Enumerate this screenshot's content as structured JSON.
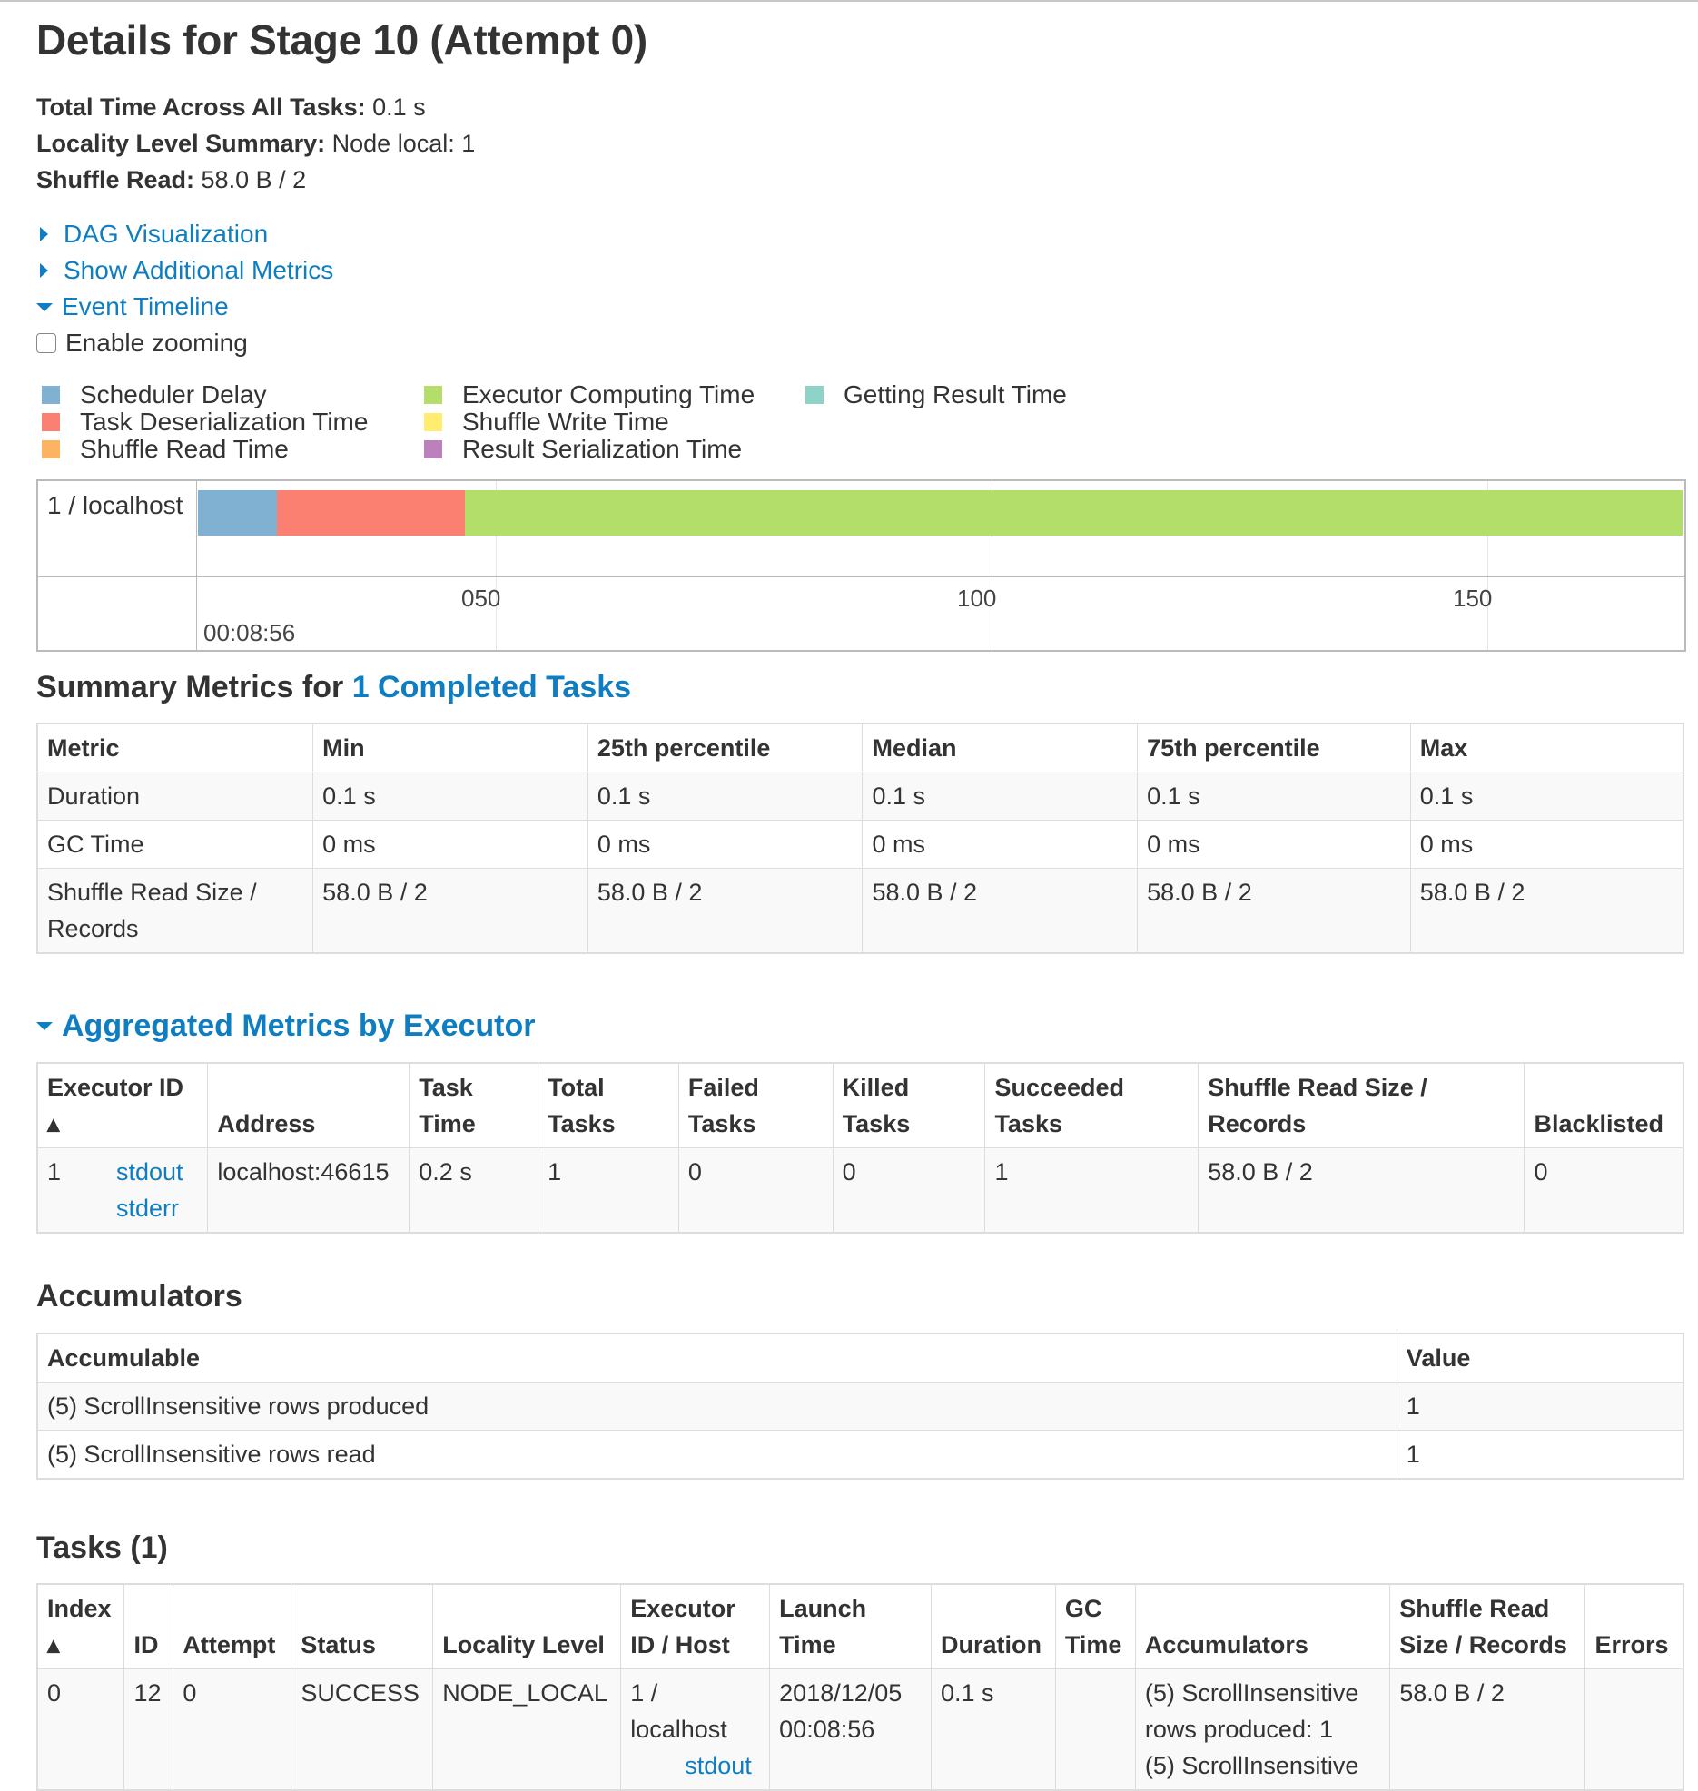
{
  "title": "Details for Stage 10 (Attempt 0)",
  "summary": {
    "total_time_label": "Total Time Across All Tasks:",
    "total_time_value": "0.1 s",
    "locality_label": "Locality Level Summary:",
    "locality_value": "Node local: 1",
    "shuffle_read_label": "Shuffle Read:",
    "shuffle_read_value": "58.0 B / 2"
  },
  "toggles": {
    "dag": "DAG Visualization",
    "additional": "Show Additional Metrics",
    "timeline": "Event Timeline",
    "zoom": "Enable zooming"
  },
  "legend": [
    {
      "label": "Scheduler Delay",
      "color": "#80b1d3"
    },
    {
      "label": "Task Deserialization Time",
      "color": "#fb8072"
    },
    {
      "label": "Shuffle Read Time",
      "color": "#fdb462"
    },
    {
      "label": "Executor Computing Time",
      "color": "#b3de69"
    },
    {
      "label": "Shuffle Write Time",
      "color": "#ffed6f"
    },
    {
      "label": "Result Serialization Time",
      "color": "#bc80bd"
    },
    {
      "label": "Getting Result Time",
      "color": "#8dd3c7"
    }
  ],
  "timeline": {
    "row_label": "1 / localhost",
    "ticks": [
      "050",
      "100",
      "150"
    ],
    "start_time": "00:08:56"
  },
  "summary_metrics": {
    "title_prefix": "Summary Metrics for",
    "title_link": "1 Completed Tasks",
    "headers": [
      "Metric",
      "Min",
      "25th percentile",
      "Median",
      "75th percentile",
      "Max"
    ],
    "rows": [
      [
        "Duration",
        "0.1 s",
        "0.1 s",
        "0.1 s",
        "0.1 s",
        "0.1 s"
      ],
      [
        "GC Time",
        "0 ms",
        "0 ms",
        "0 ms",
        "0 ms",
        "0 ms"
      ],
      [
        "Shuffle Read Size / Records",
        "58.0 B / 2",
        "58.0 B / 2",
        "58.0 B / 2",
        "58.0 B / 2",
        "58.0 B / 2"
      ]
    ]
  },
  "aggregated": {
    "title": "Aggregated Metrics by Executor",
    "headers": [
      "Executor ID ▴",
      "Address",
      "Task Time",
      "Total Tasks",
      "Failed Tasks",
      "Killed Tasks",
      "Succeeded Tasks",
      "Shuffle Read Size / Records",
      "Blacklisted"
    ],
    "row": {
      "id": "1",
      "stdout": "stdout",
      "stderr": "stderr",
      "address": "localhost:46615",
      "task_time": "0.2 s",
      "total": "1",
      "failed": "0",
      "killed": "0",
      "succeeded": "1",
      "shuffle": "58.0 B / 2",
      "blacklisted": "0"
    }
  },
  "accumulators": {
    "title": "Accumulators",
    "headers": [
      "Accumulable",
      "Value"
    ],
    "rows": [
      [
        "(5) ScrollInsensitive rows produced",
        "1"
      ],
      [
        "(5) ScrollInsensitive rows read",
        "1"
      ]
    ]
  },
  "tasks": {
    "title": "Tasks (1)",
    "headers": [
      "Index ▴",
      "ID",
      "Attempt",
      "Status",
      "Locality Level",
      "Executor ID / Host",
      "Launch Time",
      "Duration",
      "GC Time",
      "Accumulators",
      "Shuffle Read Size / Records",
      "Errors"
    ],
    "row": {
      "index": "0",
      "id": "12",
      "attempt": "0",
      "status": "SUCCESS",
      "locality": "NODE_LOCAL",
      "host_l1": "1 /",
      "host_l2": "localhost",
      "host_link": "stdout",
      "launch_l1": "2018/12/05",
      "launch_l2": "00:08:56",
      "duration": "0.1 s",
      "gc": "",
      "acc_l1": "(5) ScrollInsensitive",
      "acc_l2": "rows produced: 1",
      "acc_l3": "(5) ScrollInsensitive",
      "shuffle": "58.0 B / 2",
      "errors": ""
    }
  }
}
